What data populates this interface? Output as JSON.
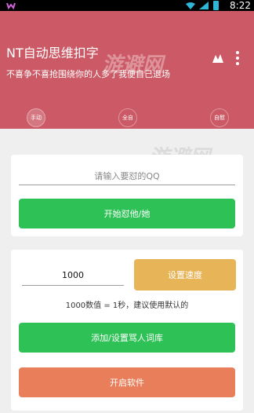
{
  "status_bar": {
    "time": "8:22"
  },
  "header": {
    "title": "NT自动思维扣字",
    "subtitle": "不喜争不喜抢围绕你的人多了我便自己退场",
    "modes": [
      "手动",
      "全自",
      "自慰"
    ]
  },
  "card_qq": {
    "qq_placeholder": "请输入要怼的QQ",
    "start_button": "开始怼他/她"
  },
  "card_speed": {
    "speed_value": "1000",
    "set_speed_button": "设置速度",
    "speed_note": "1000数值 = 1秒，建议使用默认的",
    "lexicon_button": "添加/设置骂人词库",
    "open_software_button": "开启软件"
  },
  "colors": {
    "header": "#cc5a66",
    "green": "#2ec156",
    "orange": "#e97f5a",
    "yellow": "#e8b458"
  },
  "icons": {
    "app": "app-icon",
    "wifi": "wifi-icon",
    "signal": "signal-icon",
    "battery": "battery-icon",
    "theme": "theme-icon",
    "menu": "menu-dots-icon"
  },
  "watermarks": [
    "游避网",
    "游避网",
    "游避网"
  ]
}
